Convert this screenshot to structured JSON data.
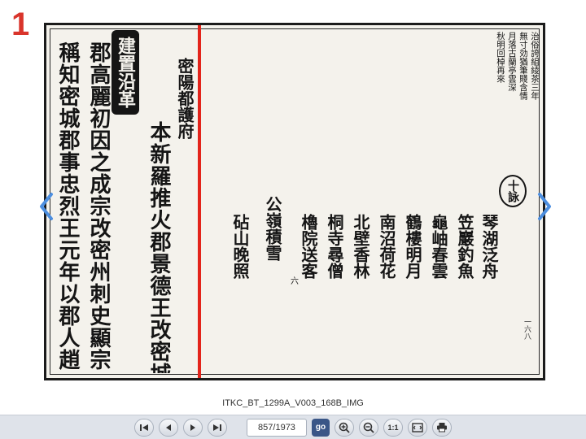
{
  "page_badge": "1",
  "scan": {
    "section_badge": "建置沿革",
    "ten_circle": "十詠",
    "leaf_number": "一六八",
    "mid_mark": "六",
    "columns_right": [
      {
        "text": "治俗誇組綾茶三年",
        "style": "small"
      },
      {
        "text": "無寸効猶筆賤含情",
        "style": "small"
      },
      {
        "text": "月落古蘭亭雲深",
        "style": "small"
      },
      {
        "text": "秋明回棹再來",
        "style": "small"
      },
      {
        "text": "琴湖泛舟",
        "style": "mid"
      },
      {
        "text": "笠巖釣魚",
        "style": "mid"
      },
      {
        "text": "龜岫春雲",
        "style": "mid"
      },
      {
        "text": "鶴樓明月",
        "style": "mid"
      },
      {
        "text": "南沼荷花",
        "style": "mid"
      },
      {
        "text": "北壁香林",
        "style": "mid"
      },
      {
        "text": "桐寺尋僧",
        "style": "mid"
      },
      {
        "text": "櫓院送客",
        "style": "mid"
      },
      {
        "text": "公嶺積雪",
        "style": "mid"
      },
      {
        "text": "砧山晚照",
        "style": "mid"
      }
    ],
    "columns_left": [
      {
        "text": "密陽都護府",
        "style": "mid"
      },
      {
        "text": "本新羅推火郡景德王改密城",
        "style": "big"
      },
      {
        "text": "郡高麗初因之成宗改密州刺史顯宗",
        "style": "big"
      },
      {
        "text": "稱知密城郡事忠烈王元年以郡人趙",
        "style": "big"
      }
    ]
  },
  "caption": "ITKC_BT_1299A_V003_168B_IMG",
  "toolbar": {
    "page_value": "857/1973",
    "go_label": "go",
    "ratio_label": "1:1"
  },
  "colors": {
    "accent_red": "#d9342b",
    "divider_red": "#e3241b",
    "nav_blue": "#4d8fe0",
    "go_blue": "#3a5687"
  }
}
